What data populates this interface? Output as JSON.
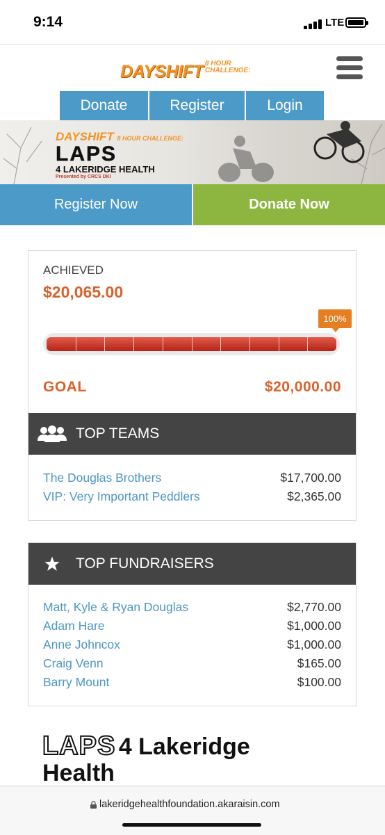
{
  "status_bar": {
    "time": "9:14",
    "network": "LTE"
  },
  "header": {
    "logo_main": "DAYSHIFT",
    "logo_sub_1": "8 HOUR",
    "logo_sub_2": "CHALLENGE:",
    "nav": [
      {
        "label": "Donate"
      },
      {
        "label": "Register"
      },
      {
        "label": "Login"
      }
    ]
  },
  "banner": {
    "dayshift": "DAYSHIFT",
    "sub": "8 HOUR CHALLENGE:",
    "laps": "LAPS",
    "lakeridge": "4 LAKERIDGE HEALTH",
    "presented": "Presented by CRCS DKI"
  },
  "cta": {
    "register": "Register Now",
    "donate": "Donate Now"
  },
  "progress": {
    "achieved_label": "ACHIEVED",
    "achieved_amount": "$20,065.00",
    "percent_label": "100%",
    "percent": 100,
    "goal_label": "GOAL",
    "goal_amount": "$20,000.00",
    "bar_color": "#c0392b",
    "badge_color": "#e67e22"
  },
  "top_teams": {
    "heading": "TOP TEAMS",
    "icon": "users-icon",
    "rows": [
      {
        "name": "The Douglas Brothers",
        "amount": "$17,700.00"
      },
      {
        "name": "VIP: Very Important Peddlers",
        "amount": "$2,365.00"
      }
    ]
  },
  "top_fundraisers": {
    "heading": "TOP FUNDRAISERS",
    "icon": "star-icon",
    "rows": [
      {
        "name": "Matt, Kyle & Ryan Douglas",
        "amount": "$2,770.00"
      },
      {
        "name": "Adam Hare",
        "amount": "$1,000.00"
      },
      {
        "name": "Anne Johncox",
        "amount": "$1,000.00"
      },
      {
        "name": "Craig Venn",
        "amount": "$165.00"
      },
      {
        "name": "Barry Mount",
        "amount": "$100.00"
      }
    ]
  },
  "page_heading": {
    "logo_word": "LAPS",
    "rest": "4 Lakeridge",
    "line2": "Health"
  },
  "browser": {
    "url": "lakeridgehealthfoundation.akaraisin.com"
  },
  "colors": {
    "blue": "#4c9ac8",
    "green": "#8db640",
    "orange": "#d9622b",
    "dark": "#444444"
  }
}
